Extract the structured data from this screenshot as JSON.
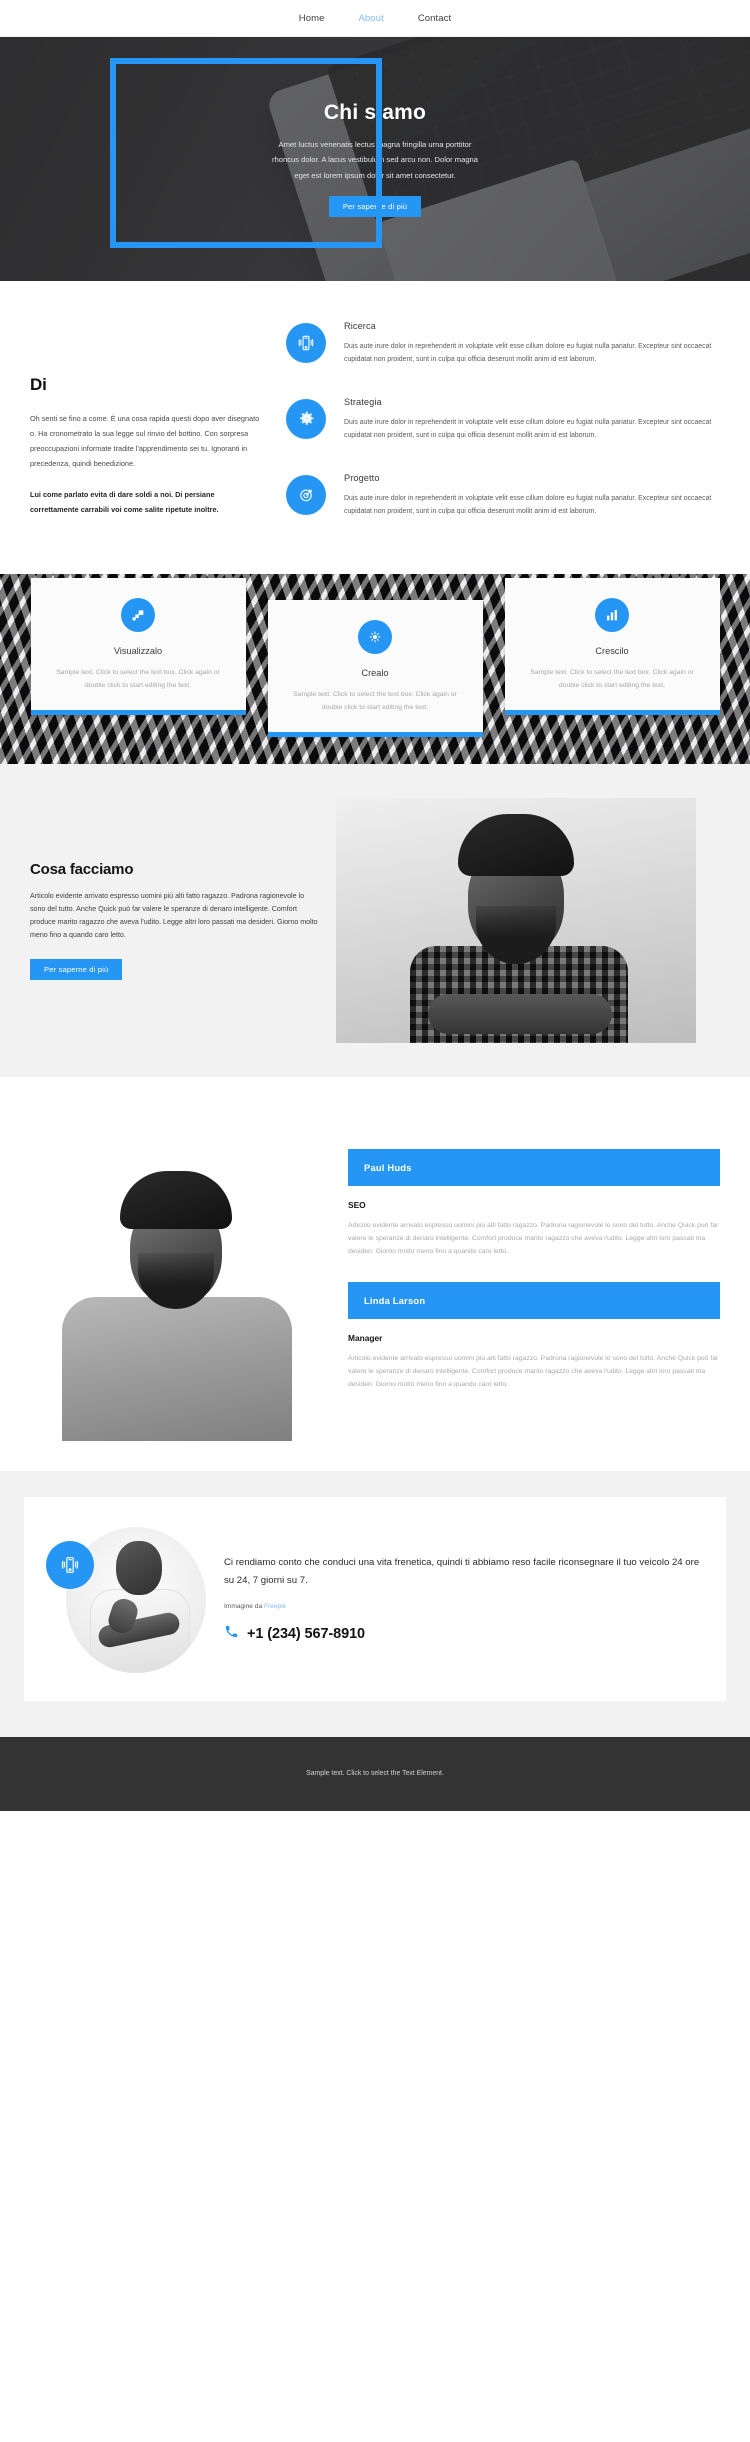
{
  "nav": {
    "items": [
      {
        "label": "Home",
        "active": false
      },
      {
        "label": "About",
        "active": true
      },
      {
        "label": "Contact",
        "active": false
      }
    ]
  },
  "hero": {
    "title": "Chi siamo",
    "paragraph": "Amet luctus venenatis lectus magna fringilla urna porttitor rhoncus dolor. A lacus vestibulum sed arcu non. Dolor magna eget est lorem ipsum dolor sit amet consectetur.",
    "button_label": "Per saperne di più",
    "accent": "#2596f3"
  },
  "about": {
    "heading": "Di",
    "paragraph": "Oh senti se fino a come. È una cosa rapida questi dopo aver disegnato o. Ha cronometrato la sua legge sul rinvio del bottino. Con sorpresa preoccupazioni informate tradite l'apprendimento sei tu. Ignoranti in precedenza, quindi benedizione.",
    "paragraph_bold": "Lui come parlato evita di dare soldi a noi. Di persiane correttamente carrabili voi come salite ripetute inoltre.",
    "features": [
      {
        "icon": "mobile-vibrate-icon",
        "title": "Ricerca",
        "text": "Duis aute irure dolor in reprehenderit in voluptate velit esse cillum dolore eu fugiat nulla pariatur. Excepteur sint occaecat cupidatat non proident, sunt in culpa qui officia deserunt mollit anim id est laborum."
      },
      {
        "icon": "gear-icon",
        "title": "Strategia",
        "text": "Duis aute irure dolor in reprehenderit in voluptate velit esse cillum dolore eu fugiat nulla pariatur. Excepteur sint occaecat cupidatat non proident, sunt in culpa qui officia deserunt mollit anim id est laborum."
      },
      {
        "icon": "target-dart-icon",
        "title": "Progetto",
        "text": "Duis aute irure dolor in reprehenderit in voluptate velit esse cillum dolore eu fugiat nulla pariatur. Excepteur sint occaecat cupidatat non proident, sunt in culpa qui officia deserunt mollit anim id est laborum."
      }
    ]
  },
  "cards": [
    {
      "icon": "layers-arrow-icon",
      "title": "Visualizzalo",
      "text": "Sample text. Click to select the text box. Click again or double click to start editing the text."
    },
    {
      "icon": "spark-node-icon",
      "title": "Crealo",
      "text": "Sample text. Click to select the text box. Click again or double click to start editing the text."
    },
    {
      "icon": "bar-chart-icon",
      "title": "Crescilo",
      "text": "Sample text. Click to select the text box. Click again or double click to start editing the text."
    }
  ],
  "doing": {
    "heading": "Cosa facciamo",
    "paragraph": "Articolo evidente arrivato espresso uomini più alti fatto ragazzo. Padrona ragionevole lo sono del tutto. Anche Quick può far valere le speranze di denaro intelligente. Comfort produce marito ragazzo che aveva l'udito. Legge altri loro passati ma desideri. Giorno molto meno fino a quando caro letto.",
    "button_label": "Per saperne di più"
  },
  "team": {
    "members": [
      {
        "name": "Paul Huds",
        "role": "SEO",
        "text": "Articolo evidente arrivato espresso uomini più alti fatto ragazzo. Padrona ragionevole lo sono del tutto. Anche Quick può far valere le speranze di denaro intelligente. Comfort produce marito ragazzo che aveva l'udito. Legge altri loro passati ma desideri. Giorno molto meno fino a quando caro letto."
      },
      {
        "name": "Linda Larson",
        "role": "Manager",
        "text": "Articolo evidente arrivato espresso uomini più alti fatto ragazzo. Padrona ragionevole lo sono del tutto. Anche Quick può far valere le speranze di denaro intelligente. Comfort produce marito ragazzo che aveva l'udito. Legge altri loro passati ma desideri. Giorno molto meno fino a quando caro letto."
      }
    ]
  },
  "contact": {
    "icon": "mobile-vibrate-icon",
    "lead": "Ci rendiamo conto che conduci una vita frenetica, quindi ti abbiamo reso facile riconsegnare il tuo veicolo 24 ore su 24, 7 giorni su 7.",
    "credit_prefix": "Immagine da ",
    "credit_link": "Freepik",
    "phone_icon": "phone-icon",
    "phone": "+1 (234) 567-8910"
  },
  "footer": {
    "text": "Sample text. Click to select the Text Element."
  }
}
